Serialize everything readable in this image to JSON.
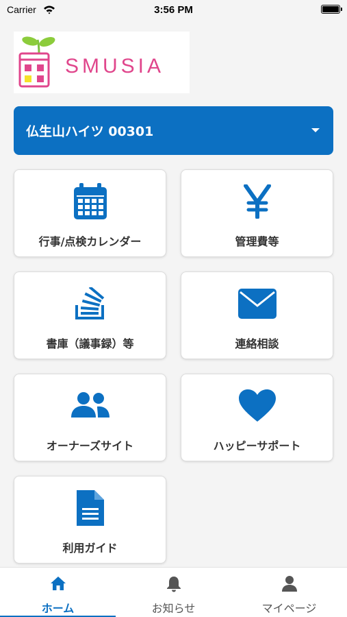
{
  "status_bar": {
    "carrier": "Carrier",
    "time": "3:56 PM"
  },
  "logo": {
    "text": "SMUSIA"
  },
  "property_selector": {
    "label": "仏生山ハイツ 00301"
  },
  "menu_tiles": [
    {
      "label": "行事/点検カレンダー",
      "icon": "calendar-icon"
    },
    {
      "label": "管理費等",
      "icon": "yen-icon"
    },
    {
      "label": "書庫（議事録）等",
      "icon": "archive-stack-icon"
    },
    {
      "label": "連絡相談",
      "icon": "envelope-icon"
    },
    {
      "label": "オーナーズサイト",
      "icon": "users-icon"
    },
    {
      "label": "ハッピーサポート",
      "icon": "heart-icon"
    },
    {
      "label": "利用ガイド",
      "icon": "document-icon"
    }
  ],
  "tab_bar": {
    "tabs": [
      {
        "label": "ホーム",
        "icon": "home-icon",
        "active": true
      },
      {
        "label": "お知らせ",
        "icon": "bell-icon",
        "active": false
      },
      {
        "label": "マイページ",
        "icon": "person-icon",
        "active": false
      }
    ]
  },
  "colors": {
    "accent": "#0c70c2",
    "brand_pink": "#e0468c",
    "background": "#f4f4f4"
  }
}
